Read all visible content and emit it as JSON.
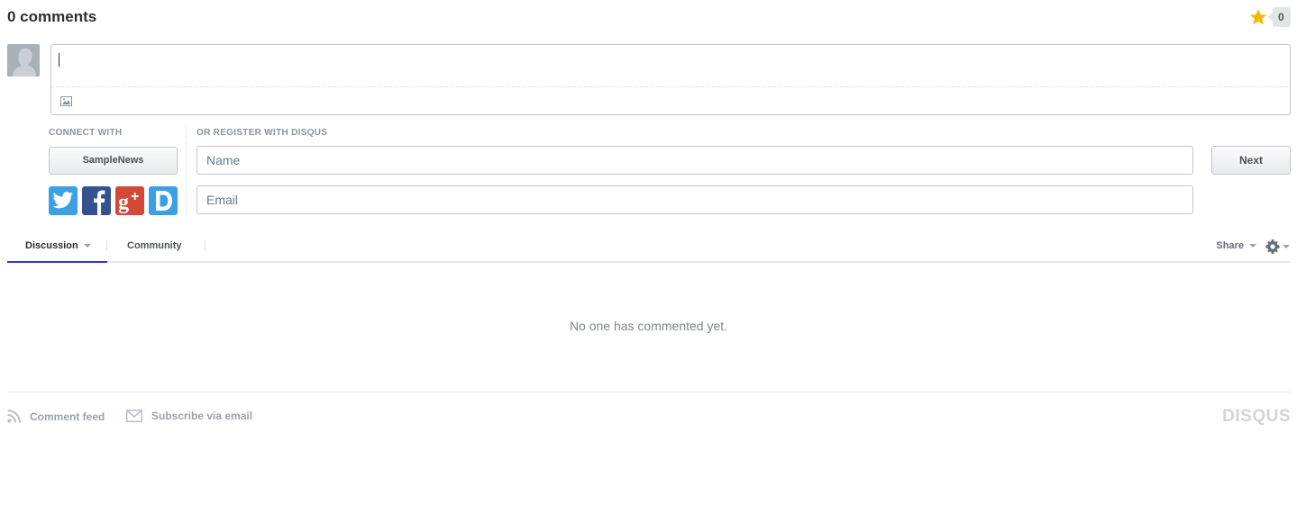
{
  "header": {
    "comment_count": "0 comments",
    "recommend_count": "0",
    "accent_color": "#f5b800"
  },
  "editor": {
    "value": "",
    "image_button_icon": "image-icon"
  },
  "connect": {
    "label": "CONNECT WITH",
    "samplenews_button": "SampleNews",
    "social_icons": [
      "twitter-icon",
      "facebook-icon",
      "google-plus-icon",
      "disqus-icon"
    ]
  },
  "register": {
    "label": "OR REGISTER WITH DISQUS",
    "name_placeholder": "Name",
    "email_placeholder": "Email",
    "next_label": "Next"
  },
  "nav": {
    "tabs": [
      {
        "label": "Discussion",
        "active": true
      },
      {
        "label": "Community",
        "active": false
      }
    ],
    "share_label": "Share",
    "active_color": "#2e36d6"
  },
  "empty_message": "No one has commented yet.",
  "footer": {
    "feed_label": "Comment feed",
    "subscribe_label": "Subscribe via email",
    "brand": "DISQUS"
  }
}
